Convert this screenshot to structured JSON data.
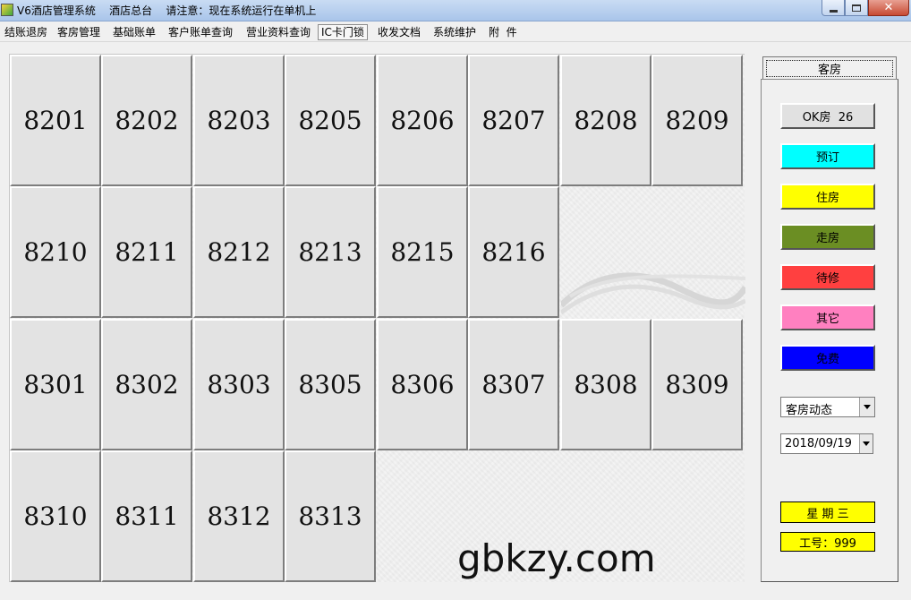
{
  "window": {
    "title": "V6酒店管理系统    酒店总台    请注意：现在系统运行在单机上"
  },
  "menu": {
    "items": [
      {
        "label": "结账退房"
      },
      {
        "label": "客房管理"
      },
      {
        "label": "基础账单"
      },
      {
        "label": "客户账单查询"
      },
      {
        "label": "营业资料查询"
      },
      {
        "label": "IC卡门锁"
      },
      {
        "label": "收发文档"
      },
      {
        "label": "系统维护"
      },
      {
        "label": "附  件"
      }
    ]
  },
  "rooms": [
    {
      "number": "8201"
    },
    {
      "number": "8202"
    },
    {
      "number": "8203"
    },
    {
      "number": "8205"
    },
    {
      "number": "8206"
    },
    {
      "number": "8207"
    },
    {
      "number": "8208"
    },
    {
      "number": "8209"
    },
    {
      "number": "8210"
    },
    {
      "number": "8211"
    },
    {
      "number": "8212"
    },
    {
      "number": "8213"
    },
    {
      "number": "8215"
    },
    {
      "number": "8216"
    },
    {
      "number": "8301"
    },
    {
      "number": "8302"
    },
    {
      "number": "8303"
    },
    {
      "number": "8305"
    },
    {
      "number": "8306"
    },
    {
      "number": "8307"
    },
    {
      "number": "8308"
    },
    {
      "number": "8309"
    },
    {
      "number": "8310"
    },
    {
      "number": "8311"
    },
    {
      "number": "8312"
    },
    {
      "number": "8313"
    }
  ],
  "watermark": "gbkzy.com",
  "side": {
    "tab_label": "客房",
    "legend": [
      {
        "label": "OK房  26",
        "color": "#e1e1e1"
      },
      {
        "label": "预订",
        "color": "#00ffff"
      },
      {
        "label": "住房",
        "color": "#ffff00"
      },
      {
        "label": "走房",
        "color": "#6b8e23"
      },
      {
        "label": "待修",
        "color": "#ff4040"
      },
      {
        "label": "其它",
        "color": "#ff80c0"
      },
      {
        "label": "免费",
        "color": "#0000ff"
      }
    ],
    "view_select": "客房动态",
    "date_select": "2018/09/19",
    "weekday": "星 期 三",
    "employee": "工号：999"
  }
}
